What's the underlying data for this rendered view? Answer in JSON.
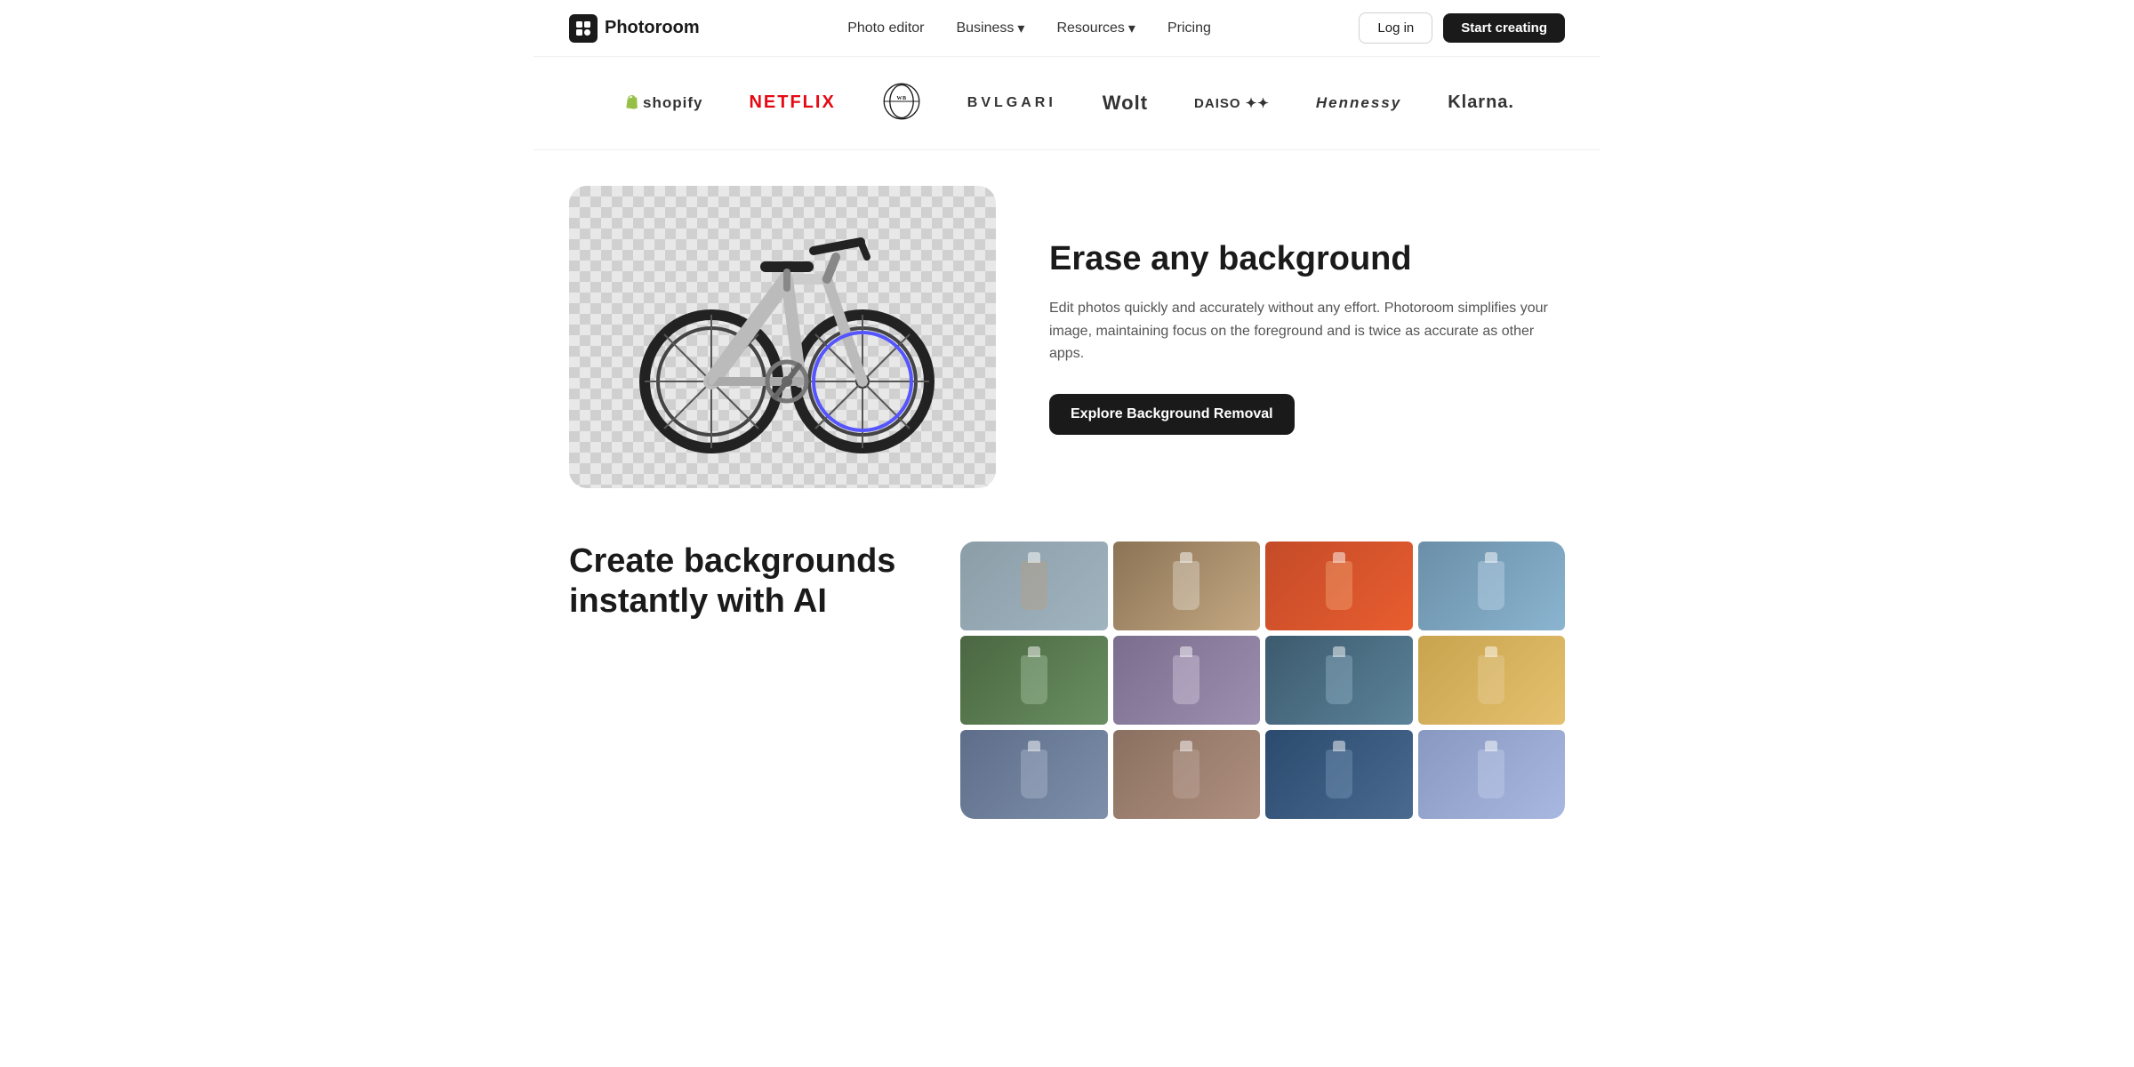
{
  "header": {
    "logo_text": "Photoroom",
    "logo_icon": "P",
    "nav": {
      "items": [
        {
          "label": "Photo editor",
          "has_chevron": false
        },
        {
          "label": "Business",
          "has_chevron": true
        },
        {
          "label": "Resources",
          "has_chevron": true
        },
        {
          "label": "Pricing",
          "has_chevron": false
        }
      ]
    },
    "actions": {
      "login_label": "Log in",
      "start_label": "Start creating"
    }
  },
  "brands": {
    "items": [
      {
        "name": "shopify",
        "label": "shopify",
        "prefix": "🛍"
      },
      {
        "name": "netflix",
        "label": "NETFLIX"
      },
      {
        "name": "warnerbros",
        "label": "WARNER\nBROS."
      },
      {
        "name": "bvlgari",
        "label": "BVLGARI"
      },
      {
        "name": "wolt",
        "label": "Wolt"
      },
      {
        "name": "daiso",
        "label": "DAISO ✦✦"
      },
      {
        "name": "hennessy",
        "label": "Hennessy"
      },
      {
        "name": "klarna",
        "label": "Klarna."
      }
    ]
  },
  "feature1": {
    "title": "Erase any background",
    "description": "Edit photos quickly and accurately without any effort. Photoroom simplifies your image, maintaining focus on the foreground and is twice as accurate as other apps.",
    "cta_label": "Explore Background Removal"
  },
  "feature2": {
    "title": "Create backgrounds instantly with AI"
  }
}
